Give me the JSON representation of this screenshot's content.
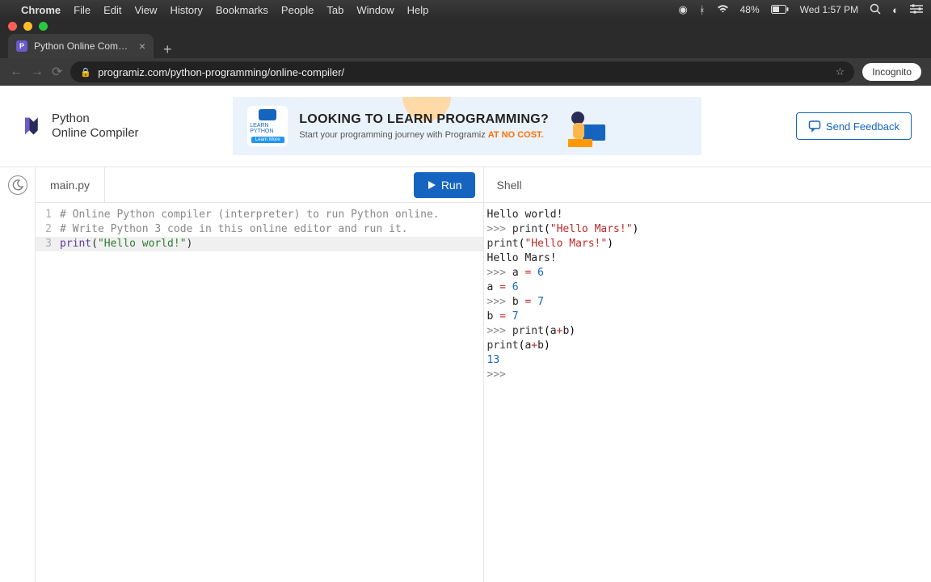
{
  "menubar": {
    "apple": "",
    "app": "Chrome",
    "items": [
      "File",
      "Edit",
      "View",
      "History",
      "Bookmarks",
      "People",
      "Tab",
      "Window",
      "Help"
    ],
    "battery": "48%",
    "datetime": "Wed 1:57 PM"
  },
  "browser": {
    "tab_title": "Python Online Compiler (Interp",
    "url": "programiz.com/python-programming/online-compiler/",
    "incognito_label": "Incognito"
  },
  "header": {
    "logo_line1": "Python",
    "logo_line2": "Online Compiler",
    "banner_title": "LOOKING TO LEARN PROGRAMMING?",
    "banner_sub_pre": "Start your programming journey with Programiz ",
    "banner_sub_accent": "AT NO COST.",
    "banner_icon_label": "LEARN PYTHON",
    "banner_icon_btn": "Learn More",
    "feedback_label": "Send Feedback"
  },
  "editor": {
    "filename": "main.py",
    "run_label": "Run",
    "lines": [
      {
        "n": "1",
        "type": "comment",
        "text": "# Online Python compiler (interpreter) to run Python online."
      },
      {
        "n": "2",
        "type": "comment",
        "text": "# Write Python 3 code in this online editor and run it."
      },
      {
        "n": "3",
        "type": "print",
        "fn": "print",
        "str": "\"Hello world!\""
      }
    ],
    "active_line": 3
  },
  "shell": {
    "title": "Shell",
    "lines": [
      {
        "kind": "plain",
        "text": "Hello world!"
      },
      {
        "kind": "in_print",
        "prompt": ">>> ",
        "fn": "print",
        "str": "\"Hello Mars!\""
      },
      {
        "kind": "echo_print",
        "fn": "print",
        "str": "\"Hello Mars!\""
      },
      {
        "kind": "plain",
        "text": "Hello Mars!"
      },
      {
        "kind": "in_assign",
        "prompt": ">>> ",
        "var": "a",
        "op": "=",
        "val": "6"
      },
      {
        "kind": "echo_assign",
        "var": "a",
        "op": "=",
        "val": "6"
      },
      {
        "kind": "in_assign",
        "prompt": ">>> ",
        "var": "b",
        "op": "=",
        "val": "7"
      },
      {
        "kind": "echo_assign",
        "var": "b",
        "op": "=",
        "val": "7"
      },
      {
        "kind": "in_expr",
        "prompt": ">>> ",
        "fn": "print",
        "expr_l": "a",
        "expr_op": "+",
        "expr_r": "b"
      },
      {
        "kind": "echo_expr",
        "fn": "print",
        "expr_l": "a",
        "expr_op": "+",
        "expr_r": "b"
      },
      {
        "kind": "num",
        "text": "13"
      },
      {
        "kind": "prompt_only",
        "prompt": ">>> "
      }
    ]
  }
}
